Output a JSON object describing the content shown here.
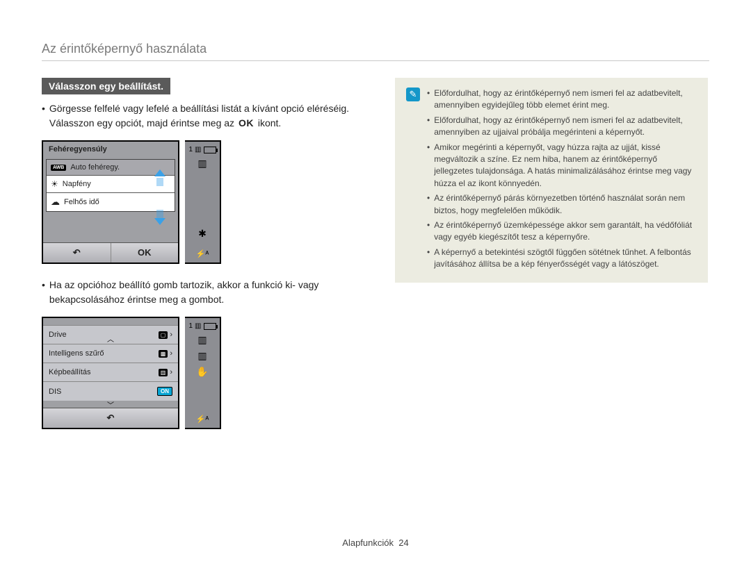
{
  "page_title": "Az érintőképernyő használata",
  "subheading": "Válasszon egy beállítást.",
  "para1_a": "Görgesse felfelé vagy lefelé a beállítási listát a kívánt opció eléréséig. Válasszon egy opciót, majd érintse meg az ",
  "para1_ok": "OK",
  "para1_b": " ikont.",
  "para2": "Ha az opcióhoz beállító gomb tartozik, akkor a funkció ki- vagy bekapcsolásához érintse meg a gombot.",
  "screen1": {
    "title": "Fehéregyensúly",
    "row1": "Auto fehéregy.",
    "row2": "Napfény",
    "row3": "Felhős idő",
    "back": "↶",
    "ok": "OK",
    "count": "1"
  },
  "screen2": {
    "row1": "Drive",
    "row2": "Intelligens szűrő",
    "row3": "Képbeállítás",
    "row4": "DIS",
    "on": "ON",
    "back": "↶",
    "count": "1"
  },
  "side_flash": "⚡ᴬ",
  "side_wb": "✱",
  "side_hand": "✋",
  "side_mem": "▥",
  "notes": [
    "Előfordulhat, hogy az érintőképernyő nem ismeri fel az adatbevitelt, amennyiben egyidejűleg több elemet érint meg.",
    "Előfordulhat, hogy az érintőképernyő nem ismeri fel az adatbevitelt, amennyiben az ujjaival próbálja megérinteni a képernyőt.",
    "Amikor megérinti a képernyőt, vagy húzza rajta az ujját, kissé megváltozik a színe. Ez nem hiba, hanem az érintőképernyő jellegzetes tulajdonsága. A hatás minimalizálásához érintse meg vagy húzza el az ikont könnyedén.",
    "Az érintőképernyő párás környezetben történő használat során nem biztos, hogy megfelelően működik.",
    "Az érintőképernyő üzemképessége akkor sem garantált, ha védőfóliát vagy egyéb kiegészítőt tesz a képernyőre.",
    "A képernyő a betekintési szögtől függően sötétnek tűnhet. A felbontás javításához állítsa be a kép fényerősségét vagy a látószöget."
  ],
  "footer_label": "Alapfunkciók",
  "footer_page": "24"
}
